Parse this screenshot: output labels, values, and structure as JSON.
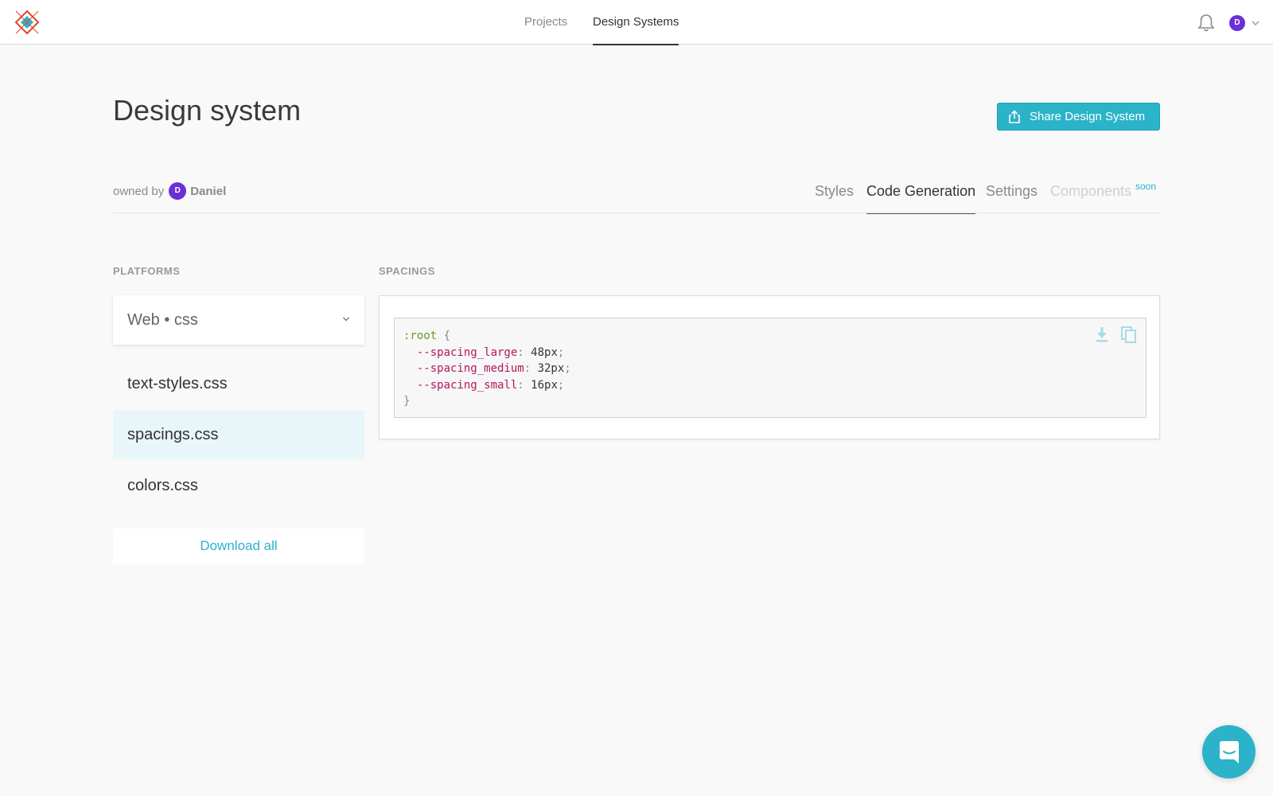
{
  "nav": {
    "tabs": [
      {
        "label": "Projects",
        "active": false
      },
      {
        "label": "Design Systems",
        "active": true
      }
    ],
    "user_initial": "D"
  },
  "header": {
    "title": "Design system",
    "share_label": "Share Design System",
    "owned_by_label": "owned by",
    "owner_initial": "D",
    "owner_name": "Daniel"
  },
  "sub_tabs": [
    {
      "label": "Styles",
      "state": "normal"
    },
    {
      "label": "Code Generation",
      "state": "active"
    },
    {
      "label": "Settings",
      "state": "normal"
    },
    {
      "label": "Components",
      "state": "disabled"
    }
  ],
  "soon_badge": "soon",
  "platforms": {
    "section_label": "PLATFORMS",
    "selected": "Web • css",
    "files": [
      {
        "label": "text-styles.css",
        "selected": false
      },
      {
        "label": "spacings.css",
        "selected": true
      },
      {
        "label": "colors.css",
        "selected": false
      }
    ],
    "download_all_label": "Download all"
  },
  "code": {
    "section_label": "SPACINGS",
    "selector": ":root",
    "open_brace": " {",
    "close_brace": "}",
    "declarations": [
      {
        "prop": "--spacing_large",
        "value": "48px"
      },
      {
        "prop": "--spacing_medium",
        "value": "32px"
      },
      {
        "prop": "--spacing_small",
        "value": "16px"
      }
    ]
  },
  "colors": {
    "accent": "#2bb3c9",
    "avatar": "#6b2fd6",
    "selected_row": "#e8f5f9"
  },
  "icons": [
    "logo-icon",
    "bell-icon",
    "chevron-down-icon",
    "share-icon",
    "download-icon",
    "copy-icon",
    "chat-icon"
  ]
}
